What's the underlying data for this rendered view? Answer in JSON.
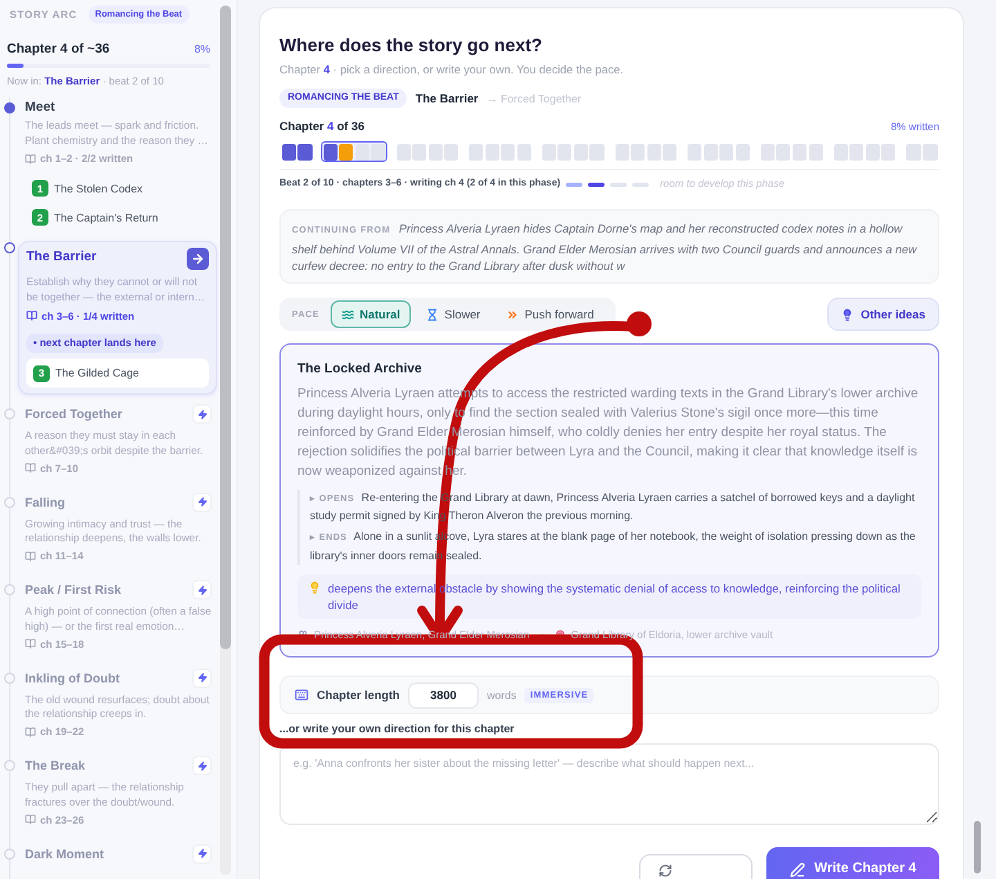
{
  "sidebar": {
    "label": "STORY ARC",
    "badge": "Romancing the Beat",
    "progress": {
      "title": "Chapter 4 of ~36",
      "percent": "8%",
      "level": 0.08,
      "status": "Now in: **The Barrier** · beat 2 of 10"
    },
    "beats": [
      {
        "kind": "done",
        "title": "Meet",
        "description": "The leads meet — spark and friction. Plant chemistry and the reason they …",
        "meta": "ch 1–2 · 2/2 written",
        "chapters": [
          {
            "number": "1",
            "title": "The Stolen Codex"
          },
          {
            "number": "2",
            "title": "The Captain's Return"
          }
        ]
      },
      {
        "kind": "current",
        "title": "The Barrier",
        "description": "Establish why they cannot or will not be together — the external or intern…",
        "meta": "ch 3–6 · 1/4 written",
        "marker": "• next chapter lands here",
        "chapters": [
          {
            "number": "3",
            "title": "The Gilded Cage"
          }
        ]
      },
      {
        "kind": "upcoming",
        "title": "Forced Together",
        "description": "A reason they must stay in each other&#039;s orbit despite the barrier.",
        "meta": "ch 7–10"
      },
      {
        "kind": "upcoming",
        "title": "Falling",
        "description": "Growing intimacy and trust — the relationship deepens, the walls lower.",
        "meta": "ch 11–14"
      },
      {
        "kind": "upcoming",
        "title": "Peak / First Risk",
        "description": "A high point of connection (often a false high) — or the first real emotion…",
        "meta": "ch 15–18"
      },
      {
        "kind": "upcoming",
        "title": "Inkling of Doubt",
        "description": "The old wound resurfaces; doubt about the relationship creeps in.",
        "meta": "ch 19–22"
      },
      {
        "kind": "upcoming",
        "title": "The Break",
        "description": "They pull apart — the relationship fractures over the doubt/wound.",
        "meta": "ch 23–26"
      },
      {
        "kind": "upcoming",
        "title": "Dark Moment"
      }
    ]
  },
  "composer": {
    "title": "Where does the story go next?",
    "subtitle": "Chapter **4** · pick a direction, or write your own. You decide the pace.",
    "arc": {
      "badge": "ROMANCING THE BEAT",
      "current": "The Barrier",
      "next": "→ Forced Together"
    },
    "chapter_map": {
      "label": "Chapter **4** of 36",
      "written": "8% written",
      "beats": [
        {
          "selected": false,
          "chapters": [
            {
              "kind": "written"
            },
            {
              "kind": "written"
            }
          ]
        },
        {
          "selected": true,
          "chapters": [
            {
              "kind": "written"
            },
            {
              "kind": "current"
            },
            {
              "kind": "planned"
            },
            {
              "kind": "planned"
            }
          ]
        },
        {
          "selected": false,
          "chapters": [
            {
              "kind": "planned"
            },
            {
              "kind": "planned"
            },
            {
              "kind": "planned"
            },
            {
              "kind": "planned"
            }
          ]
        },
        {
          "selected": false,
          "chapters": [
            {
              "kind": "planned"
            },
            {
              "kind": "planned"
            },
            {
              "kind": "planned"
            },
            {
              "kind": "planned"
            }
          ]
        },
        {
          "selected": false,
          "chapters": [
            {
              "kind": "planned"
            },
            {
              "kind": "planned"
            },
            {
              "kind": "planned"
            },
            {
              "kind": "planned"
            }
          ]
        },
        {
          "selected": false,
          "chapters": [
            {
              "kind": "planned"
            },
            {
              "kind": "planned"
            },
            {
              "kind": "planned"
            },
            {
              "kind": "planned"
            }
          ]
        },
        {
          "selected": false,
          "chapters": [
            {
              "kind": "planned"
            },
            {
              "kind": "planned"
            },
            {
              "kind": "planned"
            },
            {
              "kind": "planned"
            }
          ]
        },
        {
          "selected": false,
          "chapters": [
            {
              "kind": "planned"
            },
            {
              "kind": "planned"
            },
            {
              "kind": "planned"
            },
            {
              "kind": "planned"
            }
          ]
        },
        {
          "selected": false,
          "chapters": [
            {
              "kind": "planned"
            },
            {
              "kind": "planned"
            },
            {
              "kind": "planned"
            },
            {
              "kind": "planned"
            }
          ]
        },
        {
          "selected": false,
          "chapters": [
            {
              "kind": "planned"
            },
            {
              "kind": "planned"
            }
          ]
        }
      ]
    },
    "phase": {
      "text": "Beat 2 of 10 · chapters 3–6 · writing ch 4 (2 of 4 in this phase)",
      "steps": [
        {
          "kind": "written"
        },
        {
          "kind": "current"
        },
        {
          "kind": "planned"
        },
        {
          "kind": "planned"
        }
      ],
      "note": "room to develop this phase"
    },
    "continuing": {
      "text": "**CONTINUING FROM** Princess Alveria Lyraen hides Captain Dorne's map and her reconstructed codex notes in a hollow shelf behind Volume VII of the Astral Annals. Grand Elder Merosian arrives with two Council guards and announces a new curfew decree: no entry to the Grand Library after dusk without w"
    },
    "pace": {
      "label": "PACE",
      "options": [
        {
          "kind": "natural",
          "label": "Natural",
          "selected": true
        },
        {
          "kind": "slower",
          "label": "Slower",
          "selected": false
        },
        {
          "kind": "faster",
          "label": "Push forward",
          "selected": false
        }
      ]
    },
    "other_ideas": "Other ideas",
    "option": {
      "selected": true,
      "title": "The Locked Archive",
      "summary": "Princess Alveria Lyraen attempts to access the restricted warding texts in the Grand Library's lower archive during daylight hours, only to find the section sealed with Valerius Stone's sigil once more—this time reinforced by Grand Elder Merosian himself, who coldly denies her entry despite her royal status. The rejection solidifies the political barrier between Lyra and the Council, making it clear that knowledge itself is now weaponized against her.",
      "opens": "**▸ OPENS** Re-entering the Grand Library at dawn, Princess Alveria Lyraen carries a satchel of borrowed keys and a daylight study permit signed by King Theron Alveron the previous morning.",
      "ends": "**▸ ENDS** Alone in a sunlit alcove, Lyra stares at the blank page of her notebook, the weight of isolation pressing down as the library's inner doors remain sealed.",
      "purpose": "deepens the external obstacle by showing the systematic denial of access to knowledge, reinforcing the political divide",
      "characters": "Princess Alveria Lyraen, Grand Elder Merosian",
      "location": "Grand Library of Eldoria, lower archive vault"
    },
    "length": {
      "label": "Chapter length",
      "value": "3800",
      "unit": "words",
      "badge": "IMMERSIVE"
    },
    "direction": {
      "label": "...or write your own direction for this chapter",
      "placeholder": "e.g. 'Anna confronts her sister about the missing letter' — describe what should happen next..."
    },
    "actions": {
      "primary": "Write Chapter 4"
    }
  }
}
